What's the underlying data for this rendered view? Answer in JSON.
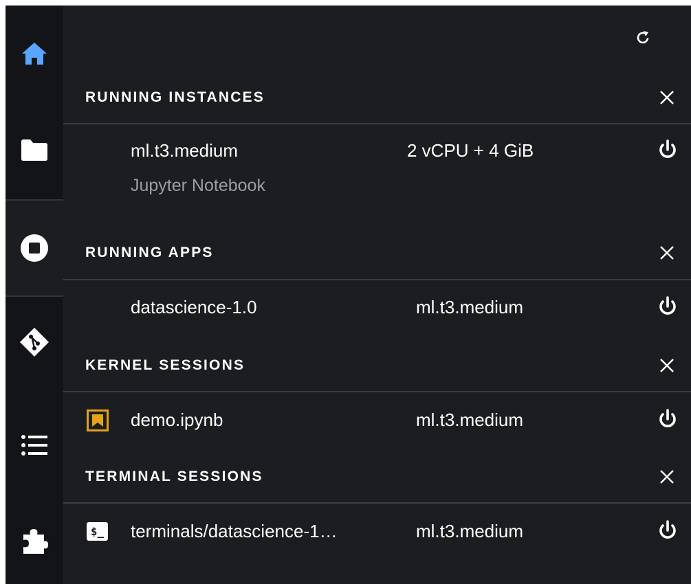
{
  "colors": {
    "accent": "#58a6ff",
    "kernel_icon": "#e3a21a",
    "text_muted": "#9c9ca4"
  },
  "rail": {
    "items": [
      {
        "name": "home-icon",
        "active": false
      },
      {
        "name": "folder-icon",
        "active": false
      },
      {
        "name": "stop-icon",
        "active": true
      },
      {
        "name": "git-icon",
        "active": false
      },
      {
        "name": "list-icon",
        "active": false
      },
      {
        "name": "extension-icon",
        "active": false
      }
    ]
  },
  "toolbar": {
    "refresh_icon": "refresh-icon"
  },
  "sections": {
    "running_instances": {
      "title": "RUNNING INSTANCES",
      "rows": [
        {
          "name": "ml.t3.medium",
          "meta": "2 vCPU + 4 GiB",
          "sub": "Jupyter Notebook"
        }
      ]
    },
    "running_apps": {
      "title": "RUNNING APPS",
      "rows": [
        {
          "name": "datascience-1.0",
          "meta": "ml.t3.medium"
        }
      ]
    },
    "kernel_sessions": {
      "title": "KERNEL SESSIONS",
      "rows": [
        {
          "name": "demo.ipynb",
          "meta": "ml.t3.medium",
          "icon": "notebook-icon"
        }
      ]
    },
    "terminal_sessions": {
      "title": "TERMINAL SESSIONS",
      "rows": [
        {
          "name": "terminals/datascience-1…",
          "meta": "ml.t3.medium",
          "icon": "terminal-icon",
          "icon_text": "$_"
        }
      ]
    }
  }
}
